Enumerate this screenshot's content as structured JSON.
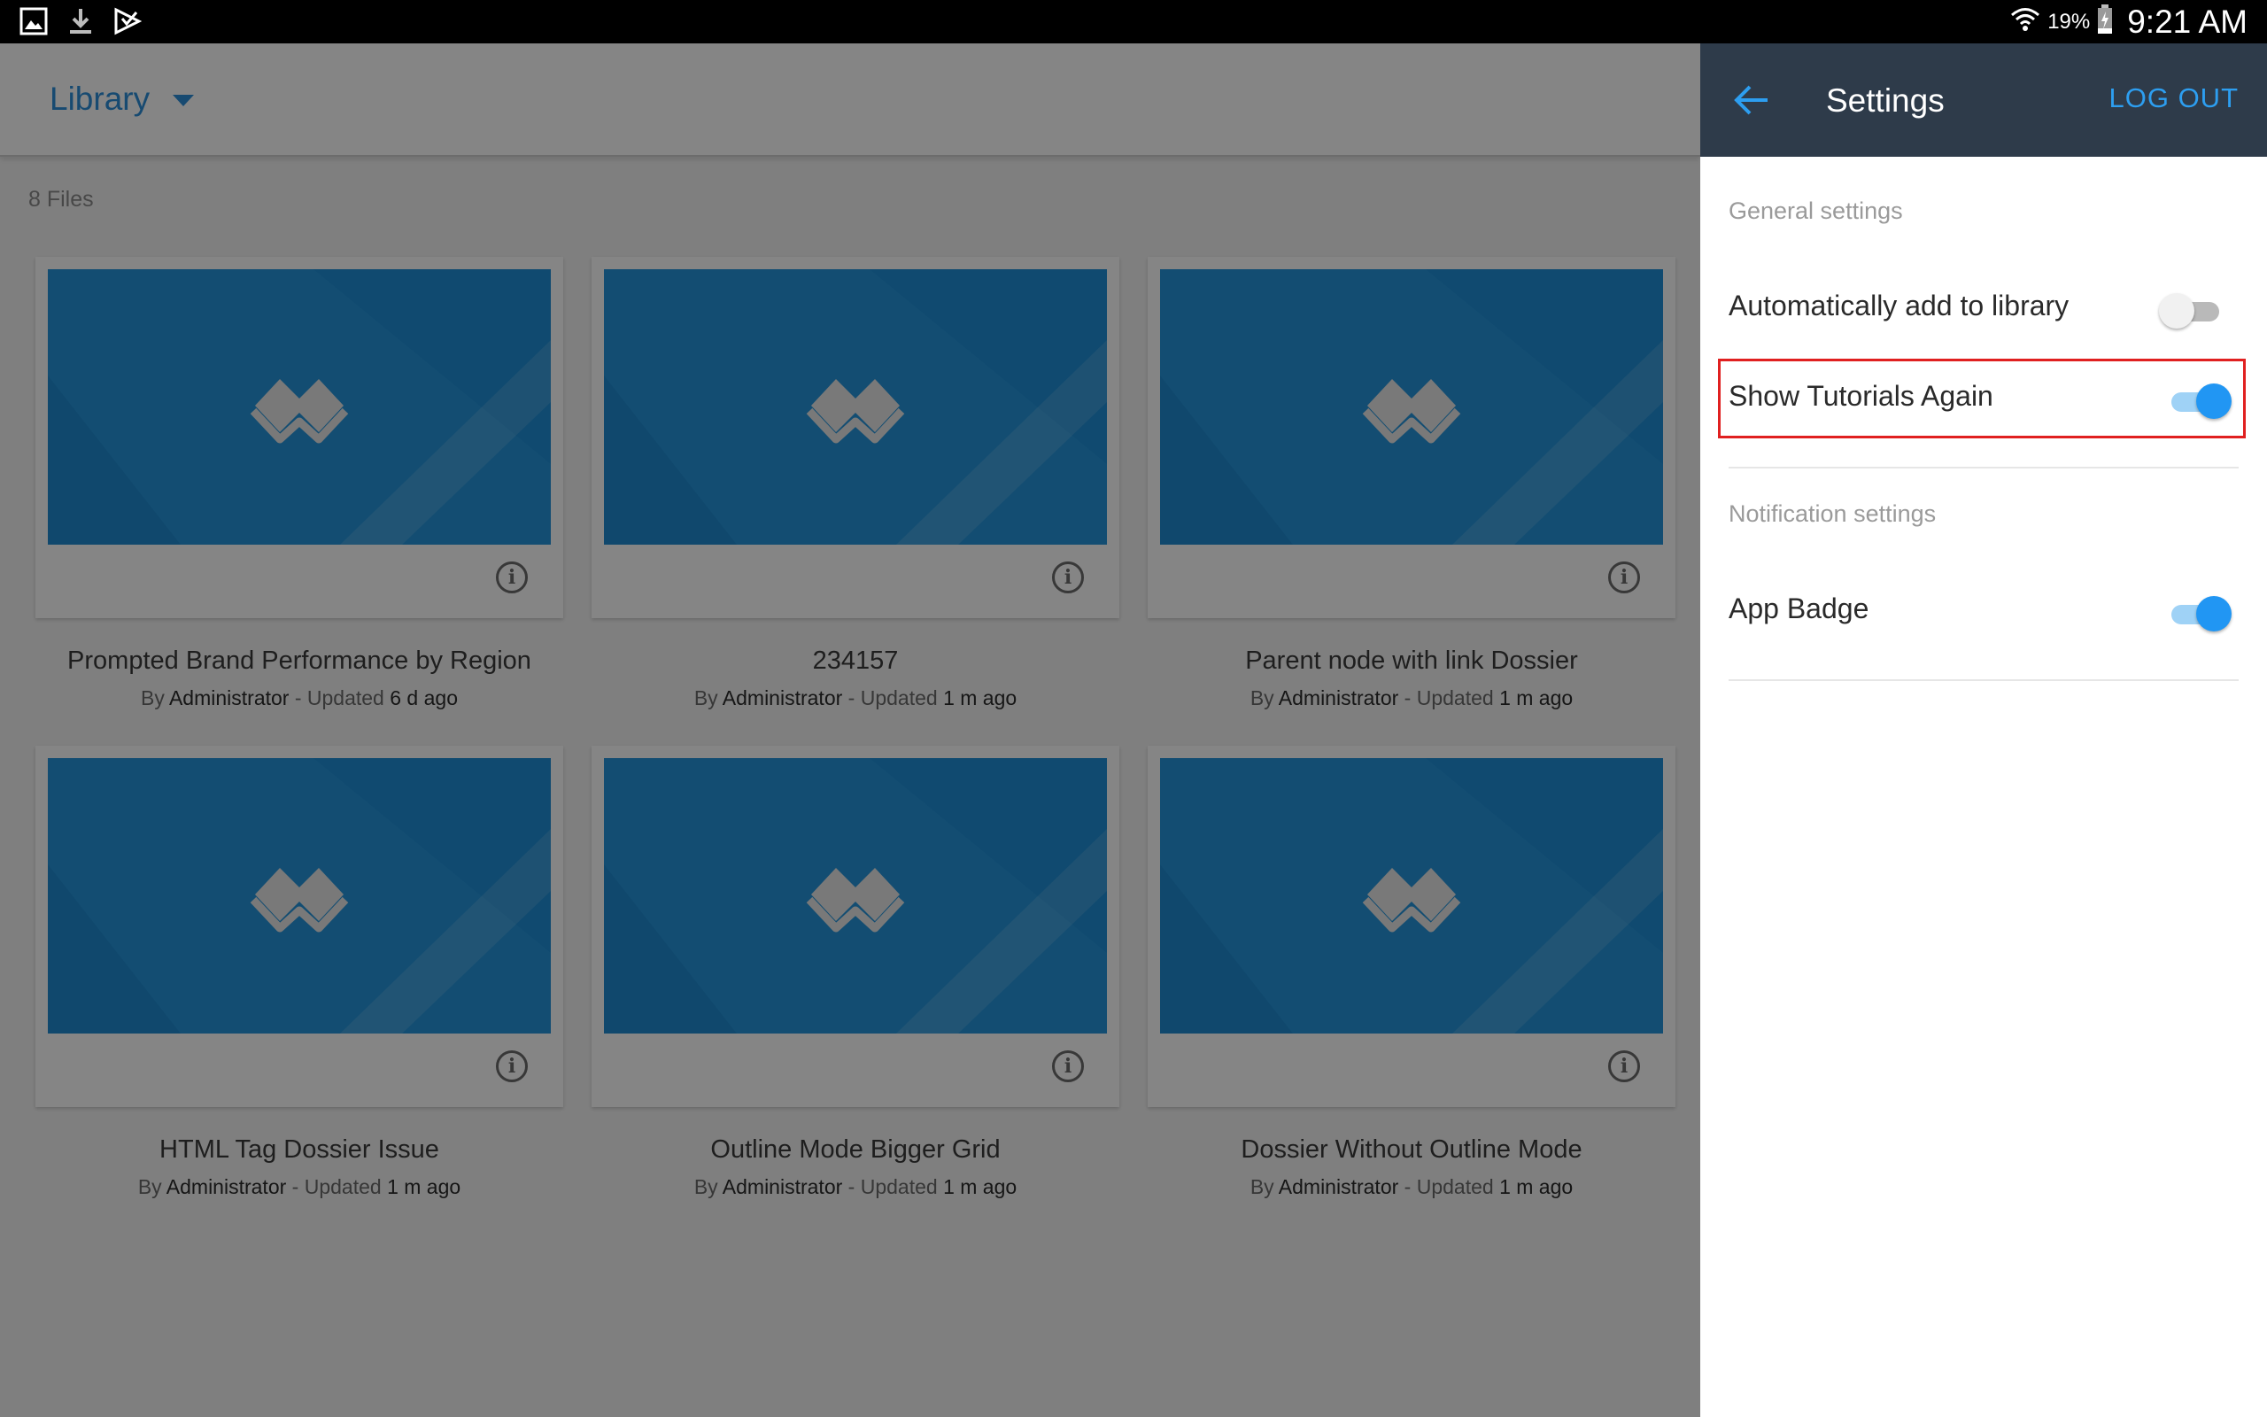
{
  "status_bar": {
    "icons_left": [
      "gallery-icon",
      "download-icon",
      "play-store-icon"
    ],
    "battery_percent": "19%",
    "time": "9:21 AM"
  },
  "library": {
    "title": "Library",
    "file_count": "8 Files",
    "cards": [
      {
        "title": "Prompted Brand Performance by Region",
        "by": "By",
        "author": "Administrator",
        "sep": " - Updated ",
        "updated": "6 d ago"
      },
      {
        "title": "234157",
        "by": "By",
        "author": "Administrator",
        "sep": " - Updated ",
        "updated": "1 m ago"
      },
      {
        "title": "Parent node with link Dossier",
        "by": "By",
        "author": "Administrator",
        "sep": " - Updated ",
        "updated": "1 m ago"
      },
      {
        "title": "HTML Tag Dossier Issue",
        "by": "By",
        "author": "Administrator",
        "sep": " - Updated ",
        "updated": "1 m ago"
      },
      {
        "title": "Outline Mode Bigger Grid",
        "by": "By",
        "author": "Administrator",
        "sep": " - Updated ",
        "updated": "1 m ago"
      },
      {
        "title": "Dossier Without Outline Mode",
        "by": "By",
        "author": "Administrator",
        "sep": " - Updated ",
        "updated": "1 m ago"
      }
    ],
    "info_glyph": "i"
  },
  "settings": {
    "title": "Settings",
    "logout_label": "LOG OUT",
    "general_label": "General settings",
    "auto_add_label": "Automatically add to library",
    "auto_add_on": false,
    "tutorials_label": "Show Tutorials Again",
    "tutorials_on": true,
    "notification_label": "Notification settings",
    "app_badge_label": "App Badge",
    "app_badge_on": true
  },
  "colors": {
    "accent": "#2d8fd9",
    "settings_header": "#2e3b4a",
    "toggle_on": "#2196f3",
    "highlight": "#e02020",
    "thumbnail": "#1f8fd6"
  }
}
